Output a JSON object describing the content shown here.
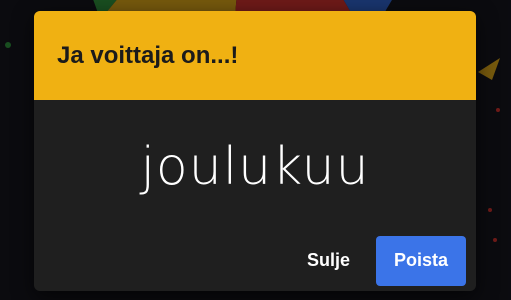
{
  "dialog": {
    "title": "Ja voittaja on...!",
    "winner": "joulukuu",
    "close_label": "Sulje",
    "remove_label": "Poista"
  },
  "colors": {
    "header_bg": "#f0b112",
    "dialog_bg": "#1f1f1f",
    "primary_button": "#3b74e8"
  }
}
